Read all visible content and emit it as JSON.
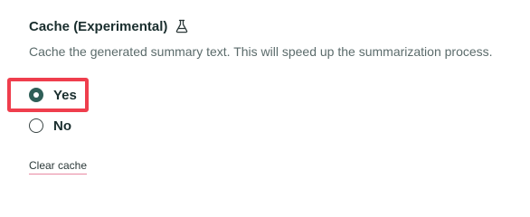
{
  "section": {
    "title": "Cache (Experimental)",
    "title_icon": "flask-icon",
    "description": "Cache the generated summary text. This will speed up the summarization process."
  },
  "options": [
    {
      "label": "Yes",
      "selected": true
    },
    {
      "label": "No",
      "selected": false
    }
  ],
  "actions": {
    "clear_cache": "Clear cache"
  },
  "colors": {
    "accent": "#2f5f58",
    "highlight": "#ef3e4d",
    "link_underline": "#e88aa3"
  }
}
